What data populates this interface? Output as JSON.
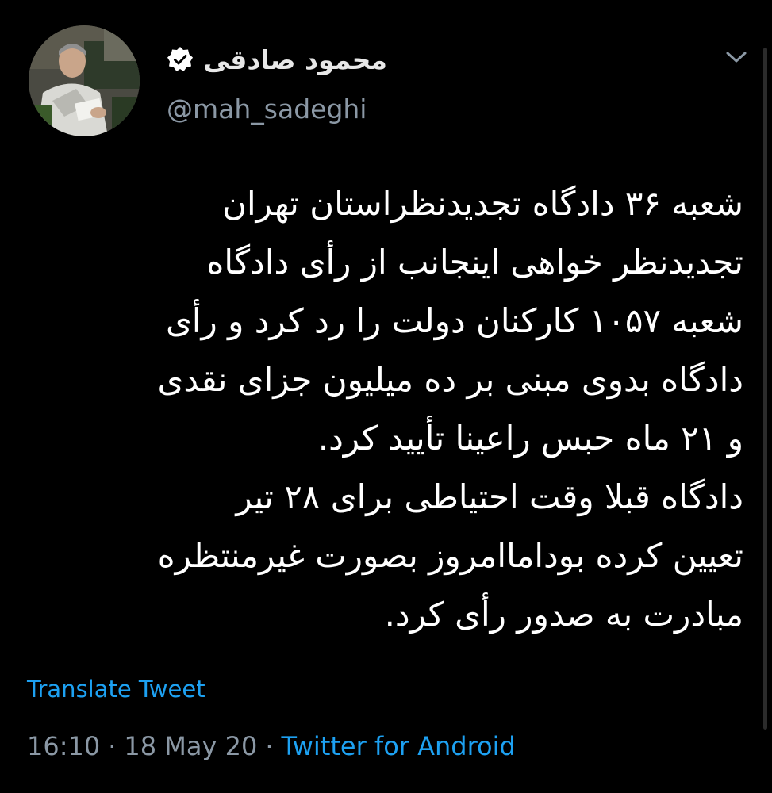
{
  "tweet": {
    "author": {
      "display_name": "محمود صادقی",
      "handle": "@mah_sadeghi",
      "verified": true,
      "avatar_icon": "profile-photo"
    },
    "menu_icon": "chevron-down-icon",
    "body_lines": [
      "شعبه ۳۶ دادگاه تجدیدنظراستان تهران",
      "تجدیدنظر خواهی اینجانب از رأی دادگاه",
      "شعبه ۱۰۵۷ کارکنان دولت را رد کرد و رأی",
      "دادگاه بدوی مبنی بر ده میلیون جزای نقدی",
      "و ۲۱ ماه حبس راعینا تأیید کرد.",
      "دادگاه قبلا وقت احتیاطی برای ۲۸ تیر",
      "تعیین کرده بوداماامروز بصورت غیرمنتظره",
      "مبادرت به صدور رأی کرد."
    ],
    "translate_label": "Translate Tweet",
    "time": "16:10",
    "date": "18 May 20",
    "separator": "·",
    "source": "Twitter for Android"
  },
  "colors": {
    "background": "#000000",
    "text": "#ffffff",
    "secondary_text": "#8b98a5",
    "link": "#1da1f2",
    "verified_badge": "#ffffff"
  }
}
